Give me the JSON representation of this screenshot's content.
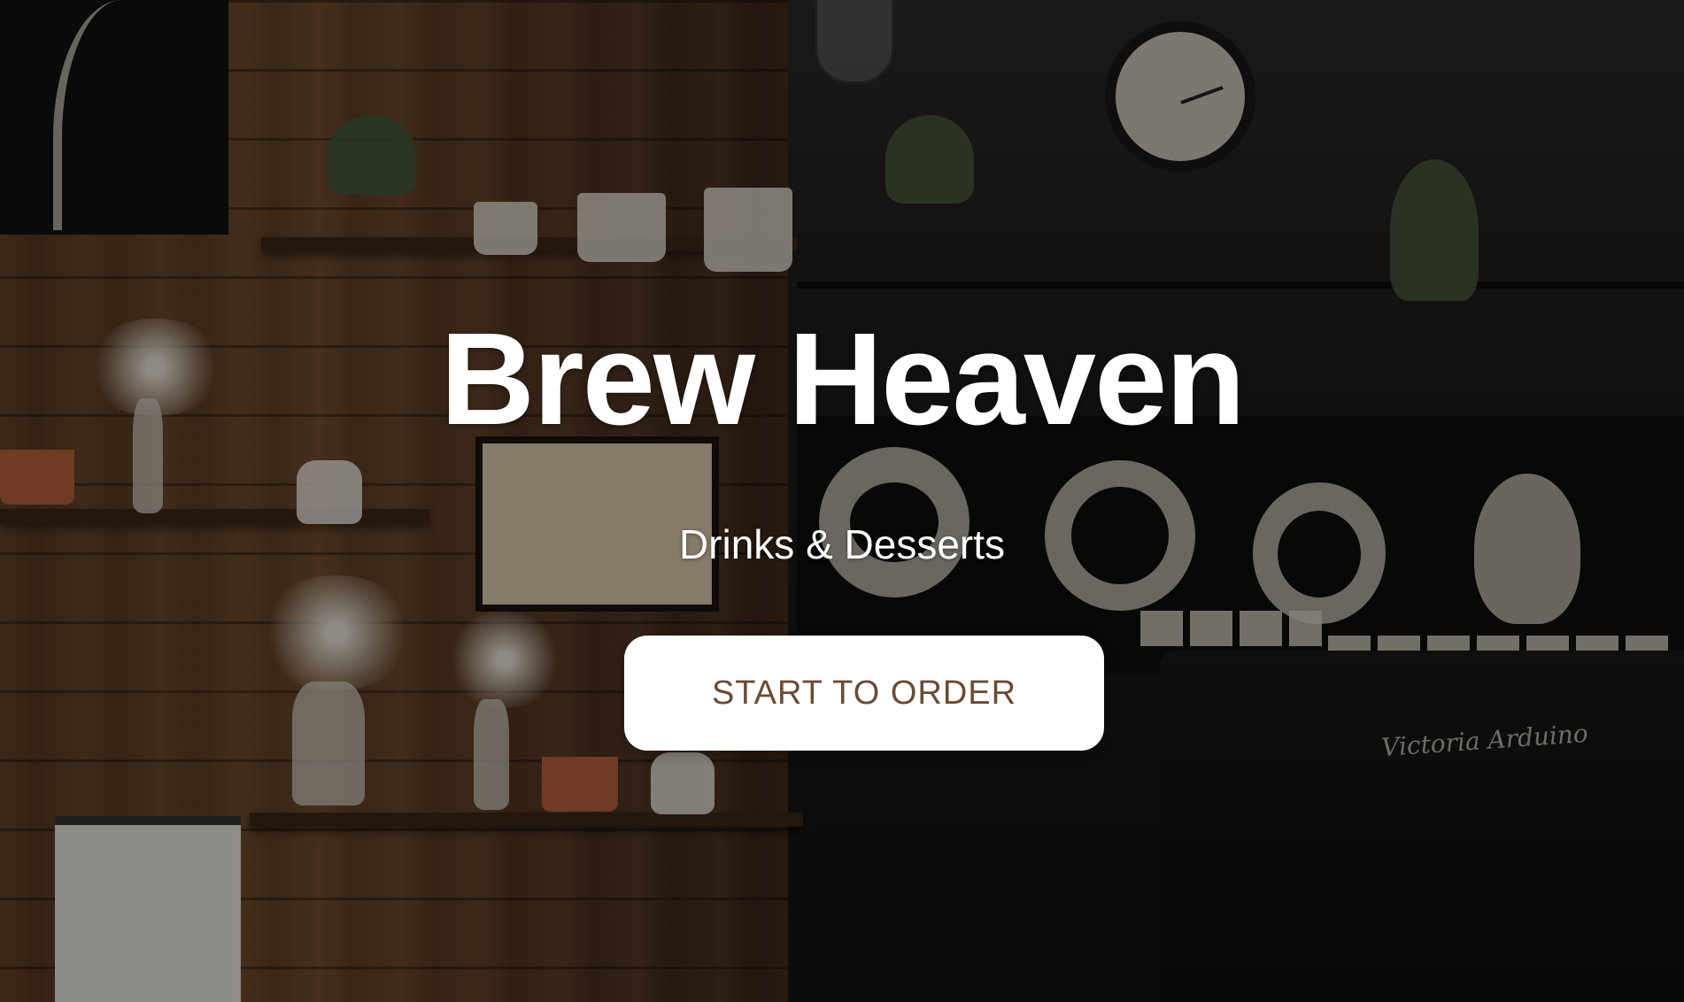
{
  "hero": {
    "title": "Brew Heaven",
    "subtitle": "Drinks & Desserts",
    "cta_label": "START TO ORDER",
    "background_image": "cafe-interior-photo",
    "colors": {
      "title": "#ffffff",
      "cta_background": "#ffffff",
      "cta_text": "#6a4b34",
      "overlay": "rgba(0,0,0,0.38)"
    }
  }
}
